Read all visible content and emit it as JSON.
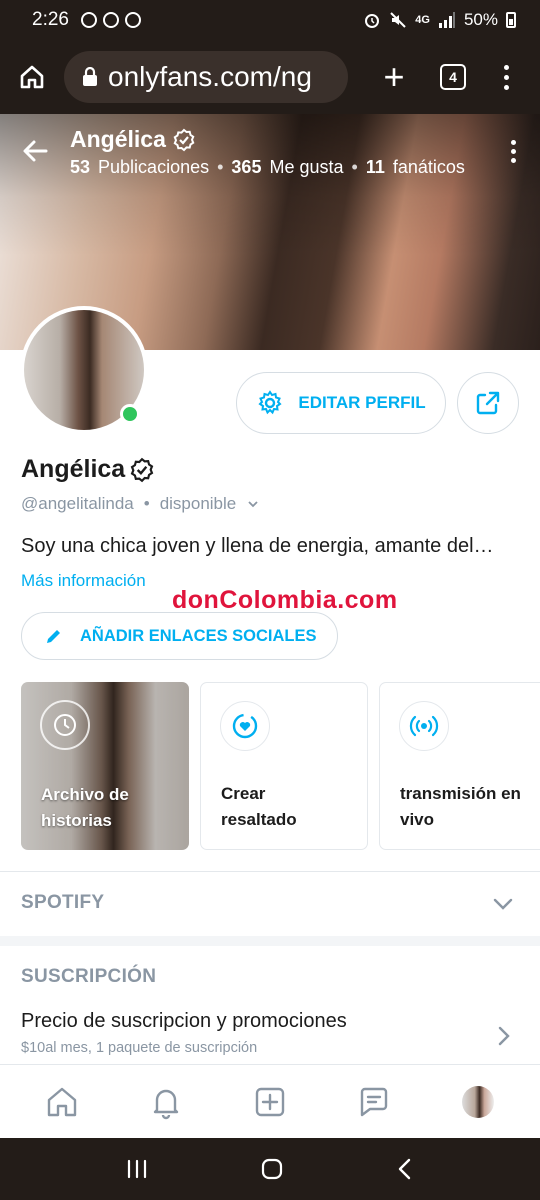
{
  "status_bar": {
    "time": "2:26",
    "network": "4G",
    "battery": "50%"
  },
  "browser": {
    "url": "onlyfans.com/ng",
    "tab_count": "4"
  },
  "cover": {
    "name": "Angélica",
    "stats": [
      {
        "value": "53",
        "label": "Publicaciones"
      },
      {
        "value": "365",
        "label": "Me gusta"
      },
      {
        "value": "11",
        "label": "fanáticos"
      }
    ]
  },
  "profile": {
    "edit_label": "EDITAR PERFIL",
    "name": "Angélica",
    "handle": "@angelitalinda",
    "status": "disponible",
    "bio": "Soy una chica joven y llena de energia, amante del…",
    "more_info": "Más información",
    "social_button": "AÑADIR ENLACES SOCIALES"
  },
  "watermark": {
    "text": "donColombia.com"
  },
  "cards": [
    {
      "label_line1": "Archivo de",
      "label_line2": "historias",
      "icon": "clock-history-icon"
    },
    {
      "label_line1": "Crear",
      "label_line2": "resaltado",
      "icon": "heart-circle-icon"
    },
    {
      "label_line1": "transmisión en",
      "label_line2": "vivo",
      "icon": "broadcast-icon"
    }
  ],
  "sections": {
    "spotify": "SPOTIFY",
    "subscription": "SUSCRIPCIÓN",
    "sub_title": "Precio de suscripcion y promociones",
    "sub_desc": "$10al mes, 1 paquete de suscripción"
  },
  "colors": {
    "accent": "#00aff0",
    "online": "#2fc55c",
    "muted": "#8a96a3"
  }
}
